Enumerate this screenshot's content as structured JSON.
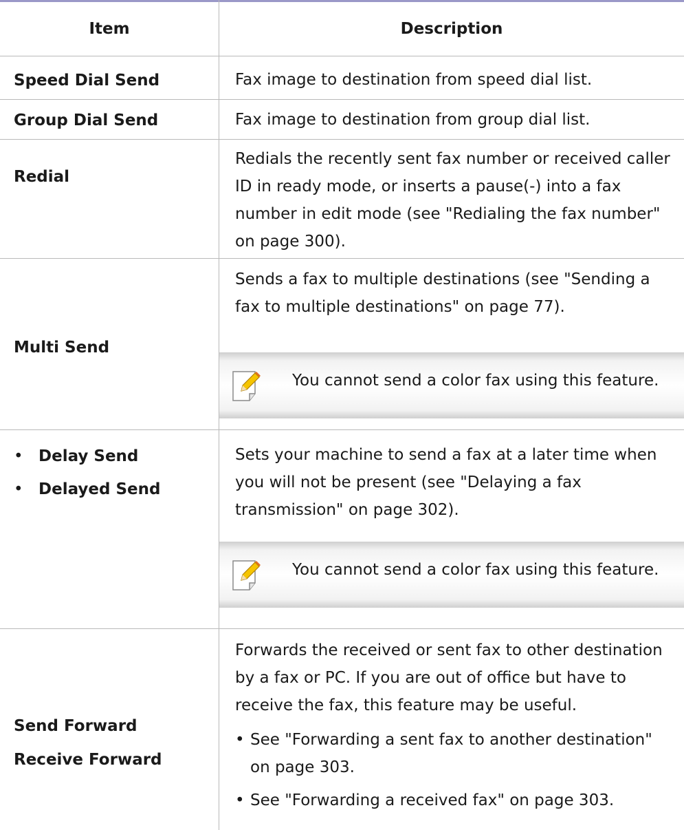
{
  "header": {
    "item": "Item",
    "description": "Description"
  },
  "rows": [
    {
      "item": "Speed Dial Send",
      "description": "Fax image to destination from speed dial list."
    },
    {
      "item": "Group Dial Send",
      "description": "Fax image to destination from group dial list."
    },
    {
      "item": "Redial",
      "description": "Redials the recently sent fax number or received caller ID in ready mode, or inserts a pause(-) into a fax number in edit mode (see \"Redialing the fax number\" on page 300)."
    },
    {
      "item": "Multi Send",
      "description": "Sends a fax to multiple destinations (see \"Sending a fax to multiple destinations\" on page 77).",
      "note": "You cannot send a color fax using this feature."
    },
    {
      "items": [
        "Delay Send",
        "Delayed Send"
      ],
      "description": "Sets your machine to send a fax at a later time when you will not be present (see \"Delaying a fax transmission\" on page 302).",
      "note": "You cannot send a color fax using this feature."
    },
    {
      "items": [
        "Send Forward",
        "Receive Forward"
      ],
      "description": "Forwards the received or sent fax to other destination by a fax or PC. If you are out of office but have to receive the fax, this feature may be useful.",
      "bullets": [
        "See \"Forwarding a sent fax to another destination\" on page 303.",
        "See \"Forwarding a received fax\" on page 303."
      ]
    }
  ],
  "icons": {
    "note": "note-pencil-icon"
  },
  "colors": {
    "top_rule": "#9a98c8",
    "grid": "#b9b9b9"
  }
}
